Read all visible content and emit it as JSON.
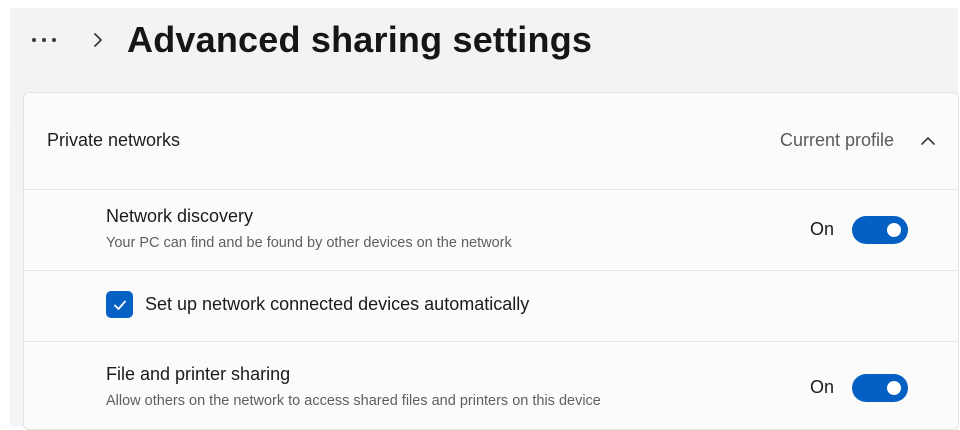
{
  "header": {
    "more_icon": "more-horizontal-icon",
    "breadcrumb_chevron_icon": "chevron-right-icon",
    "title": "Advanced sharing settings"
  },
  "section": {
    "title": "Private networks",
    "status": "Current profile",
    "collapse_icon": "chevron-up-icon",
    "expanded": true
  },
  "settings": [
    {
      "title": "Network discovery",
      "description": "Your PC can find and be found by other devices on the network",
      "state_label": "On",
      "enabled": true
    },
    {
      "checkbox_label": "Set up network connected devices automatically",
      "checked": true,
      "check_icon": "checkmark-icon"
    },
    {
      "title": "File and printer sharing",
      "description": "Allow others on the network to access shared files and printers on this device",
      "state_label": "On",
      "enabled": true
    }
  ],
  "colors": {
    "accent": "#0560c4",
    "background": "#f3f4f5",
    "card": "#fbfbfb",
    "text_primary": "#1b1b1b",
    "text_secondary": "#5f5f5f"
  }
}
